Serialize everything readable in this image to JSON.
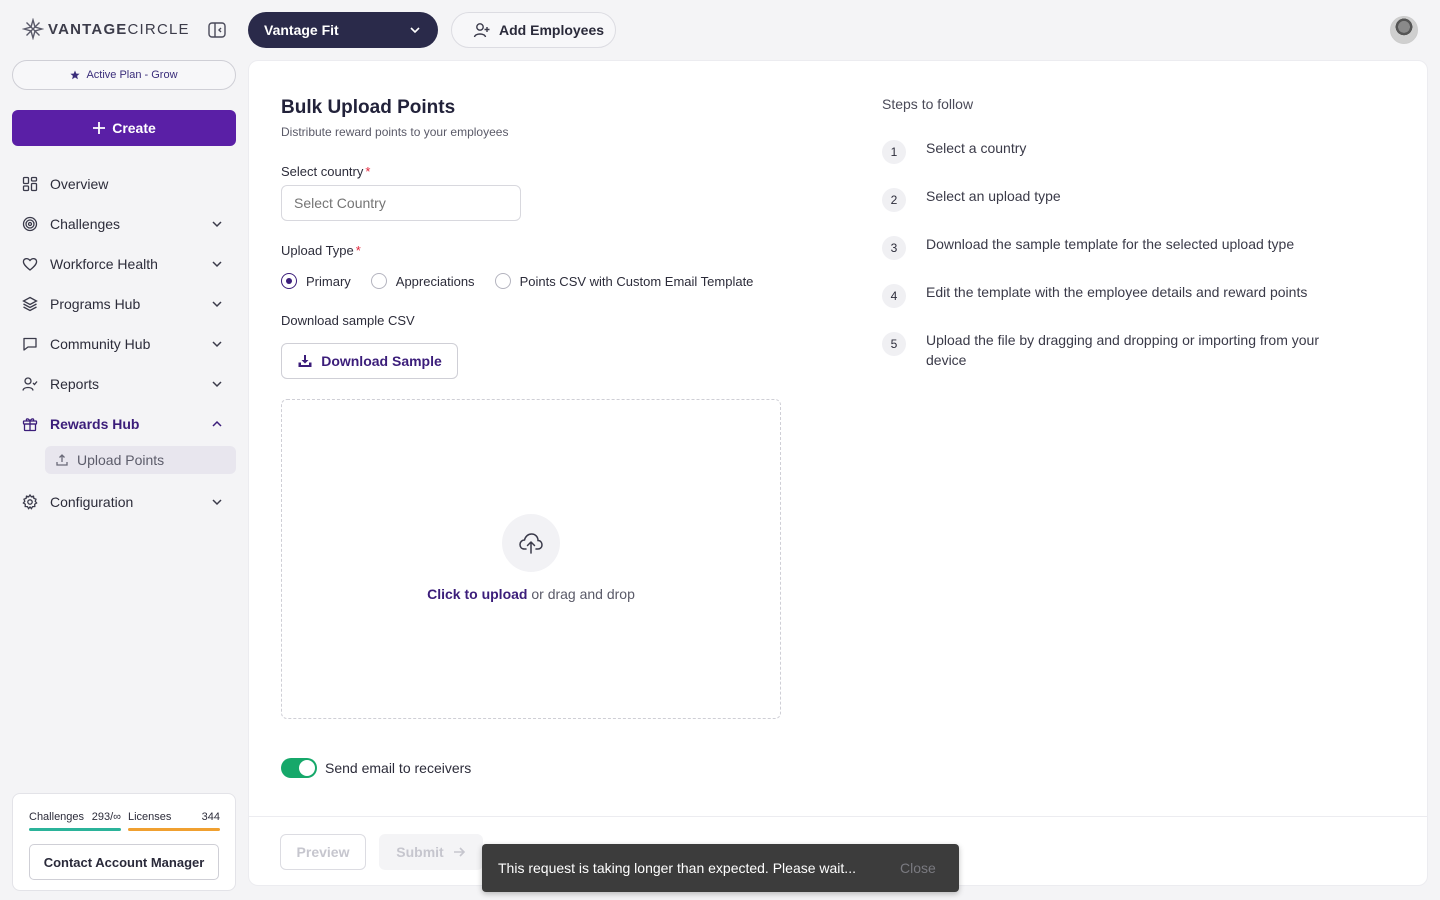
{
  "header": {
    "logo_bold": "VANTAGE",
    "logo_light": "CIRCLE",
    "product": "Vantage Fit",
    "add_employees": "Add Employees"
  },
  "sidebar": {
    "active_plan": "Active Plan - Grow",
    "create": "Create",
    "items": [
      {
        "label": "Overview"
      },
      {
        "label": "Challenges"
      },
      {
        "label": "Workforce Health"
      },
      {
        "label": "Programs Hub"
      },
      {
        "label": "Community Hub"
      },
      {
        "label": "Reports"
      },
      {
        "label": "Rewards Hub"
      },
      {
        "label": "Configuration"
      }
    ],
    "sub_item": "Upload Points",
    "usage": {
      "challenges_label": "Challenges",
      "challenges_value": "293/∞",
      "licenses_label": "Licenses",
      "licenses_value": "344",
      "challenges_color": "#2bb39a",
      "licenses_color": "#f0a030"
    },
    "contact": "Contact Account Manager"
  },
  "main": {
    "title": "Bulk Upload Points",
    "subtitle": "Distribute reward points to your employees",
    "country_label": "Select country",
    "country_placeholder": "Select Country",
    "upload_type_label": "Upload Type",
    "required_mark": "*",
    "upload_types": [
      "Primary",
      "Appreciations",
      "Points CSV with Custom Email Template"
    ],
    "selected_upload_type": "Primary",
    "download_label": "Download sample CSV",
    "download_button": "Download Sample",
    "upload_link": "Click to upload",
    "upload_rest": " or drag and drop",
    "email_toggle": "Send email to receivers",
    "email_toggle_on": true,
    "preview": "Preview",
    "submit": "Submit"
  },
  "steps": {
    "title": "Steps to follow",
    "items": [
      {
        "num": "1",
        "text": "Select a country"
      },
      {
        "num": "2",
        "text": "Select an upload type"
      },
      {
        "num": "3",
        "text": "Download the sample template for the selected upload type"
      },
      {
        "num": "4",
        "text": "Edit the template with the employee details and reward points"
      },
      {
        "num": "5",
        "text": "Upload the file by dragging and dropping or importing from your device"
      }
    ]
  },
  "toast": {
    "message": "This request is taking longer than expected. Please wait...",
    "close": "Close"
  },
  "colors": {
    "brand": "#5a1fa6",
    "brand_dark": "#3b1d7a",
    "toggle_on": "#16a86a"
  }
}
